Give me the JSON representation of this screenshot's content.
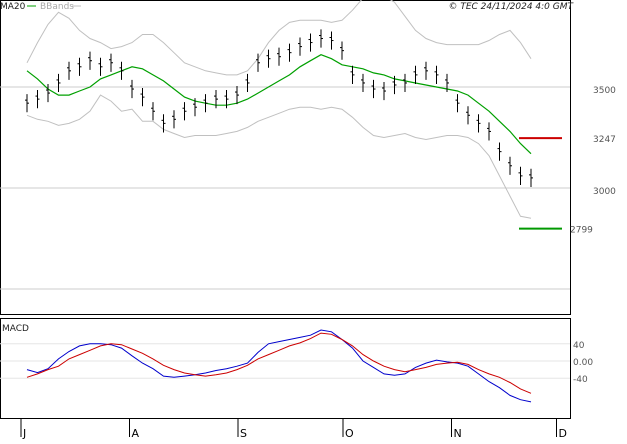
{
  "header": {
    "legend_ma": "MA20",
    "legend_bb": "BBands",
    "copyright": "© TEC 24/11/2024 4:0 GMT"
  },
  "macd": {
    "label": "MACD"
  },
  "colors": {
    "ma": "#00a000",
    "bbands": "#c0c0c0",
    "bars": "#000000",
    "resistance": "#cc0000",
    "support": "#009900",
    "macd_line": "#0000cc",
    "signal_line": "#cc0000",
    "grid": "#cccccc"
  },
  "chart_data": [
    {
      "type": "line",
      "title": "",
      "xlabel": "",
      "ylabel": "",
      "x": [
        "2024-07-01",
        "2024-07-04",
        "2024-07-07",
        "2024-07-10",
        "2024-07-13",
        "2024-07-16",
        "2024-07-19",
        "2024-07-22",
        "2024-07-25",
        "2024-07-28",
        "2024-07-31",
        "2024-08-03",
        "2024-08-06",
        "2024-08-09",
        "2024-08-12",
        "2024-08-15",
        "2024-08-18",
        "2024-08-21",
        "2024-08-24",
        "2024-08-27",
        "2024-08-30",
        "2024-09-02",
        "2024-09-05",
        "2024-09-08",
        "2024-09-11",
        "2024-09-14",
        "2024-09-17",
        "2024-09-20",
        "2024-09-23",
        "2024-09-26",
        "2024-09-29",
        "2024-10-02",
        "2024-10-05",
        "2024-10-08",
        "2024-10-11",
        "2024-10-14",
        "2024-10-17",
        "2024-10-20",
        "2024-10-23",
        "2024-10-26",
        "2024-10-29",
        "2024-11-01",
        "2024-11-04",
        "2024-11-07",
        "2024-11-10",
        "2024-11-13",
        "2024-11-16",
        "2024-11-19",
        "2024-11-22"
      ],
      "series": [
        {
          "name": "MA20",
          "values": [
            3580,
            3540,
            3490,
            3460,
            3460,
            3480,
            3500,
            3540,
            3560,
            3580,
            3600,
            3590,
            3560,
            3530,
            3490,
            3450,
            3430,
            3420,
            3410,
            3410,
            3420,
            3440,
            3470,
            3500,
            3530,
            3560,
            3600,
            3630,
            3660,
            3640,
            3610,
            3600,
            3590,
            3570,
            3560,
            3540,
            3530,
            3520,
            3510,
            3500,
            3490,
            3480,
            3460,
            3420,
            3380,
            3330,
            3280,
            3220,
            3170
          ]
        },
        {
          "name": "BBands",
          "values": [
            3620,
            3720,
            3810,
            3870,
            3840,
            3780,
            3740,
            3720,
            3690,
            3700,
            3720,
            3760,
            3760,
            3720,
            3670,
            3620,
            3600,
            3580,
            3570,
            3560,
            3560,
            3580,
            3640,
            3720,
            3780,
            3820,
            3830,
            3830,
            3830,
            3820,
            3830,
            3880,
            3940,
            3960,
            3950,
            3920,
            3850,
            3780,
            3740,
            3720,
            3710,
            3710,
            3710,
            3710,
            3730,
            3760,
            3780,
            3720,
            3640
          ]
        },
        {
          "name": "BBands",
          "values": [
            3360,
            3340,
            3330,
            3310,
            3320,
            3340,
            3380,
            3460,
            3430,
            3380,
            3390,
            3330,
            3330,
            3290,
            3270,
            3250,
            3260,
            3260,
            3260,
            3270,
            3280,
            3300,
            3330,
            3350,
            3370,
            3390,
            3400,
            3400,
            3390,
            3400,
            3390,
            3350,
            3300,
            3260,
            3250,
            3260,
            3270,
            3250,
            3240,
            3250,
            3260,
            3260,
            3250,
            3220,
            3160,
            3060,
            2960,
            2860,
            2850
          ]
        }
      ],
      "close": [
        3420,
        3440,
        3470,
        3520,
        3580,
        3600,
        3630,
        3600,
        3620,
        3580,
        3490,
        3450,
        3380,
        3320,
        3340,
        3380,
        3400,
        3420,
        3440,
        3440,
        3460,
        3520,
        3620,
        3640,
        3650,
        3670,
        3700,
        3720,
        3740,
        3730,
        3680,
        3560,
        3520,
        3490,
        3480,
        3510,
        3520,
        3560,
        3580,
        3560,
        3520,
        3420,
        3360,
        3320,
        3280,
        3180,
        3110,
        3060,
        3050
      ],
      "levels": [
        {
          "label": "3247",
          "value": 3247,
          "color": "#cc0000"
        },
        {
          "label": "2799",
          "value": 2799,
          "color": "#009900"
        }
      ],
      "yticks": [
        "3500",
        "3000"
      ],
      "ylim": [
        2500,
        4000
      ]
    },
    {
      "type": "line",
      "title": "",
      "ylim": [
        -80,
        80
      ],
      "yticks": [
        "40",
        "0.00",
        "-40"
      ],
      "xticks": [
        {
          "date": "2024-07-01",
          "label": "J"
        },
        {
          "date": "2024-08-01",
          "label": "A"
        },
        {
          "date": "2024-09-01",
          "label": "S"
        },
        {
          "date": "2024-10-01",
          "label": "O"
        },
        {
          "date": "2024-11-01",
          "label": "N"
        },
        {
          "date": "2024-12-01",
          "label": "D"
        }
      ],
      "x": [
        "2024-07-01",
        "2024-07-04",
        "2024-07-07",
        "2024-07-10",
        "2024-07-13",
        "2024-07-16",
        "2024-07-19",
        "2024-07-22",
        "2024-07-25",
        "2024-07-28",
        "2024-07-31",
        "2024-08-03",
        "2024-08-06",
        "2024-08-09",
        "2024-08-12",
        "2024-08-15",
        "2024-08-18",
        "2024-08-21",
        "2024-08-24",
        "2024-08-27",
        "2024-08-30",
        "2024-09-02",
        "2024-09-05",
        "2024-09-08",
        "2024-09-11",
        "2024-09-14",
        "2024-09-17",
        "2024-09-20",
        "2024-09-23",
        "2024-09-26",
        "2024-09-29",
        "2024-10-02",
        "2024-10-05",
        "2024-10-08",
        "2024-10-11",
        "2024-10-14",
        "2024-10-17",
        "2024-10-20",
        "2024-10-23",
        "2024-10-26",
        "2024-10-29",
        "2024-11-01",
        "2024-11-04",
        "2024-11-07",
        "2024-11-10",
        "2024-11-13",
        "2024-11-16",
        "2024-11-19",
        "2024-11-22"
      ],
      "series": [
        {
          "name": "MACD",
          "values": [
            -20,
            -27,
            -18,
            5,
            22,
            35,
            40,
            40,
            38,
            30,
            12,
            -5,
            -18,
            -35,
            -38,
            -35,
            -32,
            -28,
            -22,
            -18,
            -12,
            -5,
            20,
            40,
            45,
            50,
            55,
            60,
            72,
            68,
            50,
            30,
            0,
            -15,
            -30,
            -33,
            -30,
            -15,
            -5,
            2,
            -2,
            -5,
            -12,
            -30,
            -48,
            -62,
            -80,
            -90,
            -95
          ]
        },
        {
          "name": "Signal",
          "values": [
            -38,
            -30,
            -20,
            -12,
            5,
            15,
            25,
            35,
            40,
            38,
            28,
            18,
            5,
            -10,
            -20,
            -28,
            -32,
            -35,
            -32,
            -28,
            -20,
            -10,
            5,
            15,
            25,
            35,
            42,
            52,
            65,
            62,
            50,
            35,
            15,
            0,
            -12,
            -20,
            -25,
            -20,
            -15,
            -8,
            -5,
            -3,
            -8,
            -20,
            -30,
            -38,
            -50,
            -65,
            -75
          ]
        }
      ]
    }
  ]
}
